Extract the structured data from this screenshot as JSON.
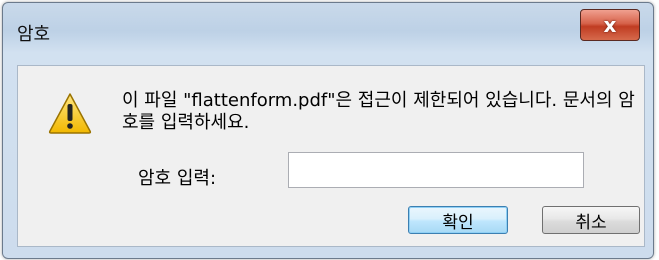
{
  "window": {
    "title": "암호",
    "close_label": "x"
  },
  "dialog": {
    "icon": "warning-icon",
    "message": "이 파일 \"flattenform.pdf\"은 접근이 제한되어 있습니다. 문서의 암호를 입력하세요.",
    "password_label": "암호 입력:",
    "password_value": "",
    "ok_label": "확인",
    "cancel_label": "취소"
  },
  "colors": {
    "warning_fill": "#f2c200",
    "close_button": "#c8452a",
    "default_button_border": "#3c7fb1"
  }
}
